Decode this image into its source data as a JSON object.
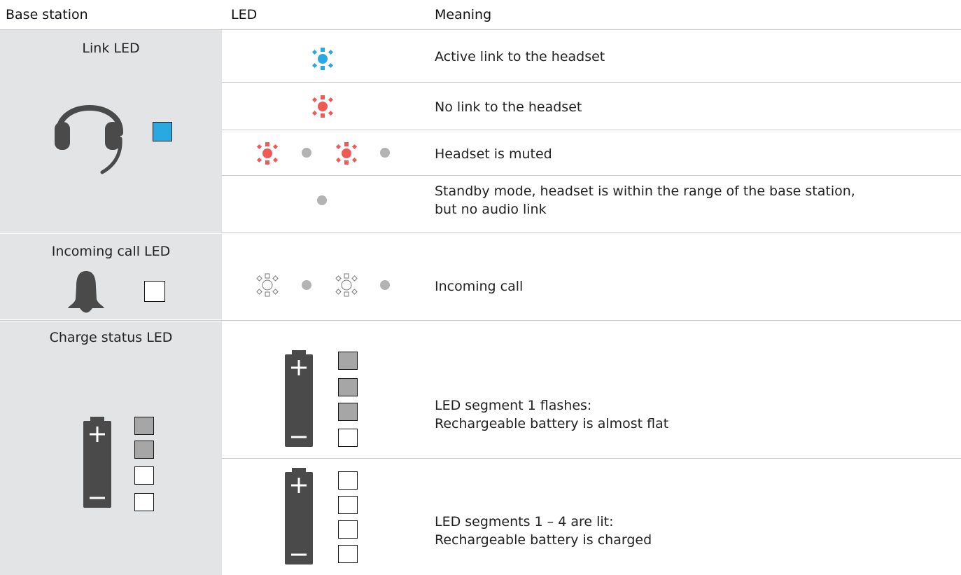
{
  "columns": {
    "base_station": "Base station",
    "led": "LED",
    "meaning": "Meaning"
  },
  "groups": {
    "link": {
      "title": "Link LED"
    },
    "incoming": {
      "title": "Incoming call LED"
    },
    "charge": {
      "title": "Charge status LED"
    }
  },
  "rows": [
    {
      "meaning": "Active link to the headset",
      "led_color": "#29a9e1"
    },
    {
      "meaning": "No link to the headset",
      "led_color": "#f05a55"
    },
    {
      "meaning": "Headset is muted",
      "led_color": "#f05a55"
    },
    {
      "meaning": [
        "Standby mode, headset is within the range of the base station,",
        "but no audio link"
      ]
    },
    {
      "meaning": "Incoming call",
      "led_color": "#ffffff"
    },
    {
      "meaning": [
        "LED segment 1 flashes:",
        "Rechargeable battery is almost flat"
      ]
    },
    {
      "meaning": [
        "LED segments 1 – 4 are lit:",
        "Rechargeable battery is charged"
      ]
    }
  ],
  "colors": {
    "panel": "#e3e4e6",
    "link_indicator": "#29a9e1",
    "segment_lit": "#a6a6a6",
    "segment_off": "#ffffff",
    "dot_off": "#b3b3b3",
    "icon_dark": "#4a4a4a"
  },
  "icons": [
    "headset-icon",
    "bell-icon",
    "battery-icon",
    "led-burst-icon",
    "led-off-dot-icon"
  ],
  "base_battery_segments": [
    "lit",
    "lit",
    "off",
    "off"
  ],
  "led_battery_segments": {
    "almost_flat": [
      "lit",
      "lit",
      "lit",
      "off"
    ],
    "charged": [
      "off",
      "off",
      "off",
      "off"
    ]
  }
}
